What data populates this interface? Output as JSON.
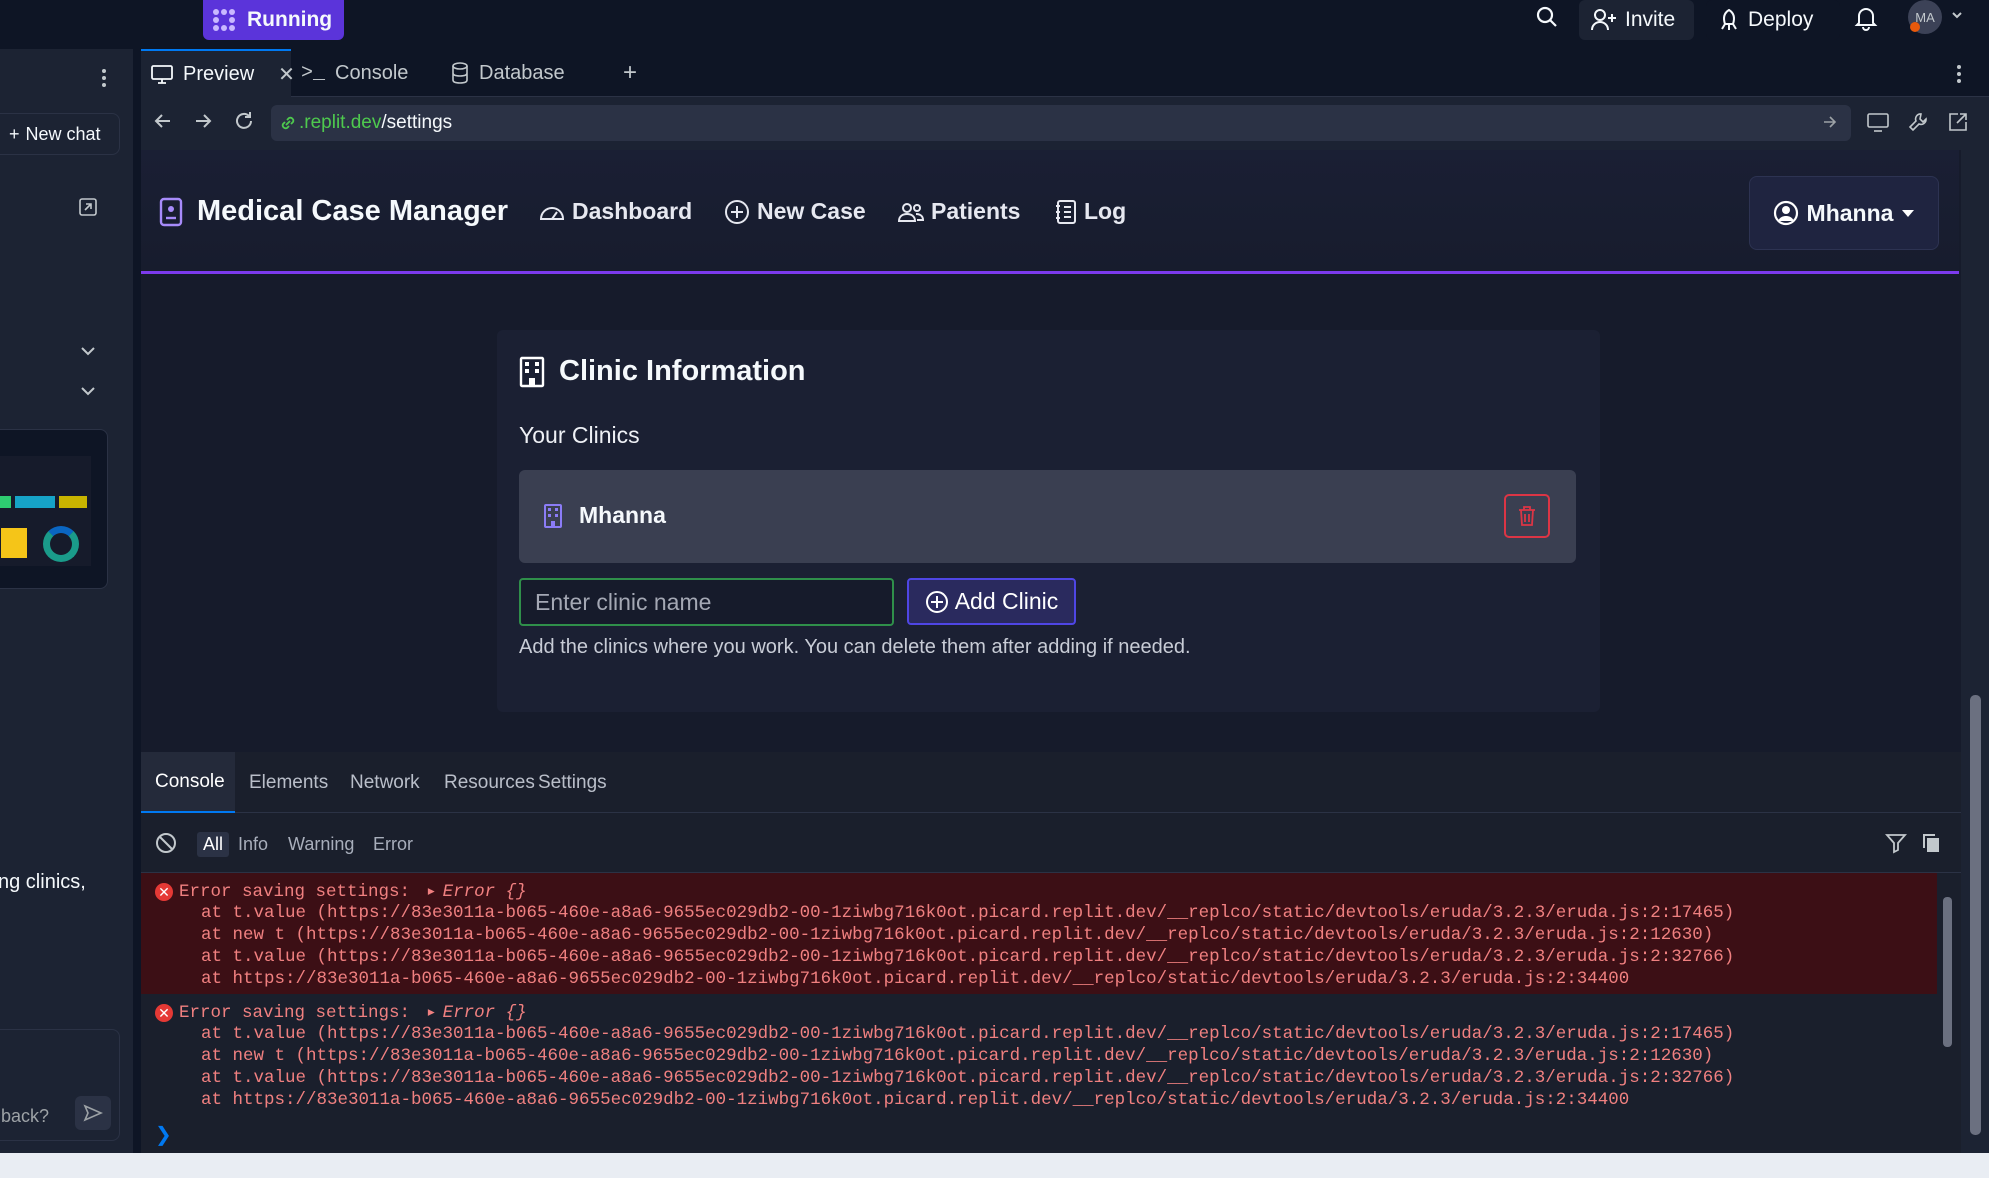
{
  "topbar": {
    "status_label": "Running",
    "invite_label": "Invite",
    "deploy_label": "Deploy",
    "avatar_initials": "MA"
  },
  "left_panel": {
    "new_chat_label": "New chat",
    "partial_text": "ng clinics,",
    "partial_input": "back?"
  },
  "workspace_tabs": [
    {
      "label": "Preview"
    },
    {
      "label": "Console"
    },
    {
      "label": "Database"
    }
  ],
  "url": {
    "domain": ".replit.dev",
    "path": "/settings"
  },
  "app": {
    "brand": "Medical Case Manager",
    "nav": [
      {
        "label": "Dashboard",
        "icon": "dashboard-icon"
      },
      {
        "label": "New Case",
        "icon": "plus-circle-icon"
      },
      {
        "label": "Patients",
        "icon": "people-icon"
      },
      {
        "label": "Log",
        "icon": "journal-icon"
      }
    ],
    "user_menu_label": "Mhanna"
  },
  "clinic_card": {
    "title": "Clinic Information",
    "subtitle": "Your Clinics",
    "clinics": [
      {
        "name": "Mhanna"
      }
    ],
    "input_placeholder": "Enter clinic name",
    "add_button_label": "Add Clinic",
    "help_text": "Add the clinics where you work. You can delete them after adding if needed."
  },
  "devtools": {
    "tabs": [
      "Console",
      "Elements",
      "Network",
      "Resources",
      "Settings"
    ],
    "filters": [
      "All",
      "Info",
      "Warning",
      "Error"
    ],
    "entries": [
      {
        "message": "Error saving settings:",
        "object": "Error {}",
        "stack": [
          "at t.value (https://83e3011a-b065-460e-a8a6-9655ec029db2-00-1ziwbg716k0ot.picard.replit.dev/__replco/static/devtools/eruda/3.2.3/eruda.js:2:17465)",
          "at new t (https://83e3011a-b065-460e-a8a6-9655ec029db2-00-1ziwbg716k0ot.picard.replit.dev/__replco/static/devtools/eruda/3.2.3/eruda.js:2:12630)",
          "at t.value (https://83e3011a-b065-460e-a8a6-9655ec029db2-00-1ziwbg716k0ot.picard.replit.dev/__replco/static/devtools/eruda/3.2.3/eruda.js:2:32766)",
          "at https://83e3011a-b065-460e-a8a6-9655ec029db2-00-1ziwbg716k0ot.picard.replit.dev/__replco/static/devtools/eruda/3.2.3/eruda.js:2:34400"
        ]
      },
      {
        "message": "Error saving settings:",
        "object": "Error {}",
        "stack": [
          "at t.value (https://83e3011a-b065-460e-a8a6-9655ec029db2-00-1ziwbg716k0ot.picard.replit.dev/__replco/static/devtools/eruda/3.2.3/eruda.js:2:17465)",
          "at new t (https://83e3011a-b065-460e-a8a6-9655ec029db2-00-1ziwbg716k0ot.picard.replit.dev/__replco/static/devtools/eruda/3.2.3/eruda.js:2:12630)",
          "at t.value (https://83e3011a-b065-460e-a8a6-9655ec029db2-00-1ziwbg716k0ot.picard.replit.dev/__replco/static/devtools/eruda/3.2.3/eruda.js:2:32766)",
          "at https://83e3011a-b065-460e-a8a6-9655ec029db2-00-1ziwbg716k0ot.picard.replit.dev/__replco/static/devtools/eruda/3.2.3/eruda.js:2:34400"
        ]
      }
    ]
  },
  "colors": {
    "accent": "#7c3aed",
    "danger": "#dc3545",
    "running": "#5b34da"
  }
}
